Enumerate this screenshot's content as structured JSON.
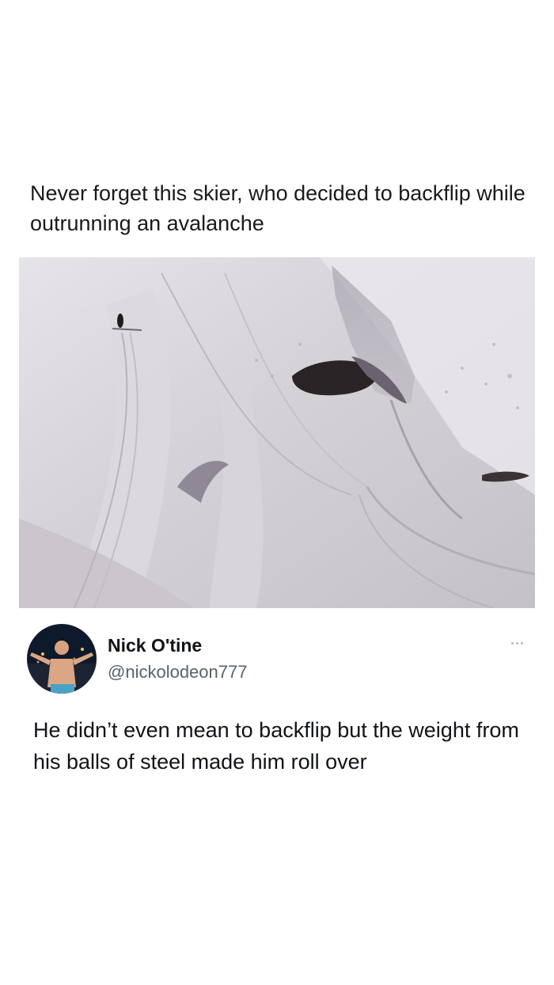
{
  "post": {
    "caption": "Never forget this skier, who decided to backflip while outrunning an avalanche"
  },
  "media": {
    "icon": "avalanche-photo"
  },
  "reply": {
    "author_name": "Nick O'tine",
    "author_handle": "@nickolodeon777",
    "more_icon": "more-dots-icon",
    "text": "He didn’t even mean to backflip but the weight from his balls of steel made him roll over"
  }
}
